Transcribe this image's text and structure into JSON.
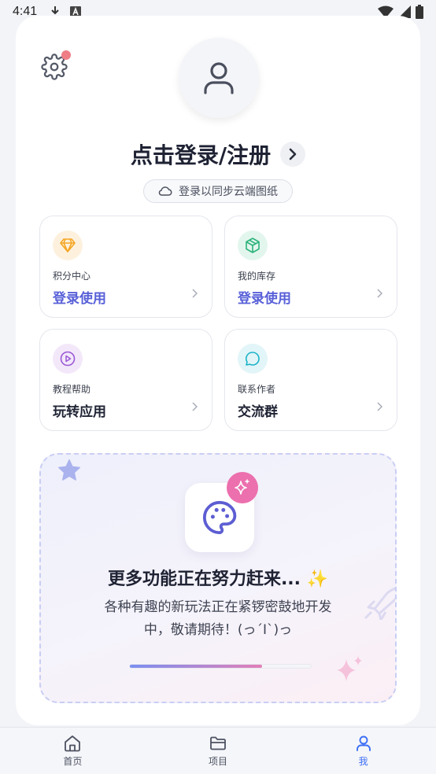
{
  "status_bar": {
    "time": "4:41",
    "left_icons": [
      "download-icon",
      "font-a-icon"
    ],
    "right_icons": [
      "wifi-icon",
      "signal-icon",
      "battery-icon"
    ]
  },
  "profile": {
    "login_title": "点击登录/注册",
    "cloud_sync": "登录以同步云端图纸",
    "settings_has_badge": true
  },
  "tiles": [
    {
      "label": "积分中心",
      "value": "登录使用",
      "icon": "diamond-icon",
      "accent": "#f5a623",
      "value_color": "#5860d8"
    },
    {
      "label": "我的库存",
      "value": "登录使用",
      "icon": "box-icon",
      "accent": "#2bb37a",
      "value_color": "#5860d8"
    },
    {
      "label": "教程帮助",
      "value": "玩转应用",
      "icon": "play-circle-icon",
      "accent": "#9b59d6",
      "value_color": "#1f2333"
    },
    {
      "label": "联系作者",
      "value": "交流群",
      "icon": "chat-bubble-icon",
      "accent": "#1ab3c8",
      "value_color": "#1f2333"
    }
  ],
  "promo": {
    "title": "更多功能正在努力赶来... ✨",
    "desc_line1": "各种有趣的新玩法正在紧锣密鼓地开发",
    "desc_line2": "中，敬请期待！(っ´Ι`)っ",
    "progress": 0.73
  },
  "bottom_nav": [
    {
      "label": "首页",
      "icon": "home-icon",
      "active": false
    },
    {
      "label": "项目",
      "icon": "folder-icon",
      "active": false
    },
    {
      "label": "我",
      "icon": "user-icon",
      "active": true
    }
  ],
  "colors": {
    "accent_blue": "#3d6ff5",
    "accent_indigo": "#5860d8",
    "badge_red": "#ef7e86",
    "sparkle_pink": "#ec6fae"
  }
}
